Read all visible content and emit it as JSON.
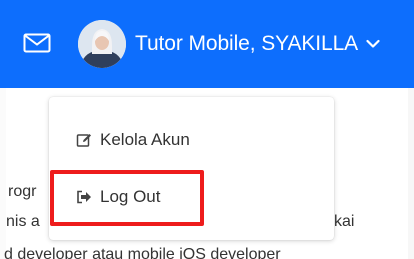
{
  "navbar": {
    "background_color": "#0d6efd",
    "mail_icon": "envelope-icon",
    "user_name": "Tutor Mobile, SYAKILLA",
    "caret_icon": "chevron-down-icon"
  },
  "background_text": {
    "line1": "rogr",
    "line2": "nis a",
    "line2_right": "kai",
    "line3": "d developer atau mobile iOS developer"
  },
  "dropdown": {
    "items": [
      {
        "label": "Kelola Akun",
        "icon": "edit-icon"
      },
      {
        "label": "Log Out",
        "icon": "sign-out-icon"
      }
    ]
  },
  "highlight": {
    "color": "#ee1c1c"
  }
}
